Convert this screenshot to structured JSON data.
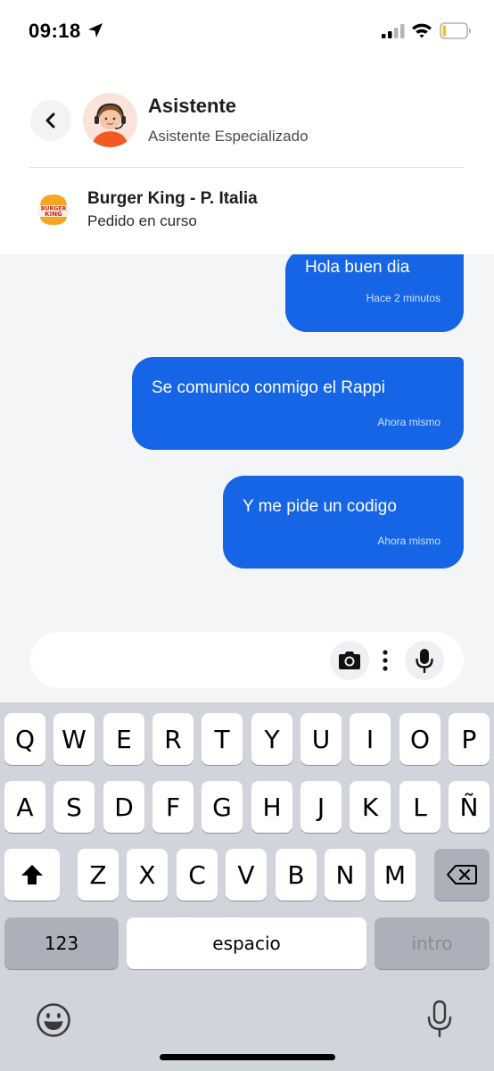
{
  "status_bar": {
    "time": "09:18"
  },
  "header": {
    "agent_name": "Asistente",
    "agent_subtitle": "Asistente Especializado",
    "store_logo_text": [
      "BURGER",
      "KING"
    ],
    "store_name": "Burger King - P. Italia",
    "order_status": "Pedido en curso"
  },
  "messages": [
    {
      "text": "Hola buen dia",
      "time": "Hace 2 minutos"
    },
    {
      "text": "Se comunico conmigo el Rappi",
      "time": "Ahora mismo"
    },
    {
      "text": "Y me pide un codigo",
      "time": "Ahora mismo"
    }
  ],
  "composer": {
    "placeholder": ""
  },
  "keyboard": {
    "row1": [
      "Q",
      "W",
      "E",
      "R",
      "T",
      "Y",
      "U",
      "I",
      "O",
      "P"
    ],
    "row2": [
      "A",
      "S",
      "D",
      "F",
      "G",
      "H",
      "J",
      "K",
      "L",
      "Ñ"
    ],
    "row3": [
      "Z",
      "X",
      "C",
      "V",
      "B",
      "N",
      "M"
    ],
    "numbers_label": "123",
    "space_label": "espacio",
    "return_label": "intro"
  },
  "colors": {
    "bubble": "#1565e6",
    "chat_background": "#f4f5f7",
    "keyboard_background": "#d1d4da",
    "brand_orange": "#f15a22"
  },
  "icons": [
    "location-arrow-icon",
    "signal-icon",
    "wifi-icon",
    "battery-icon",
    "chevron-left-icon",
    "camera-icon",
    "more-vertical-icon",
    "microphone-icon",
    "shift-icon",
    "backspace-icon",
    "emoji-icon",
    "dictation-icon"
  ]
}
